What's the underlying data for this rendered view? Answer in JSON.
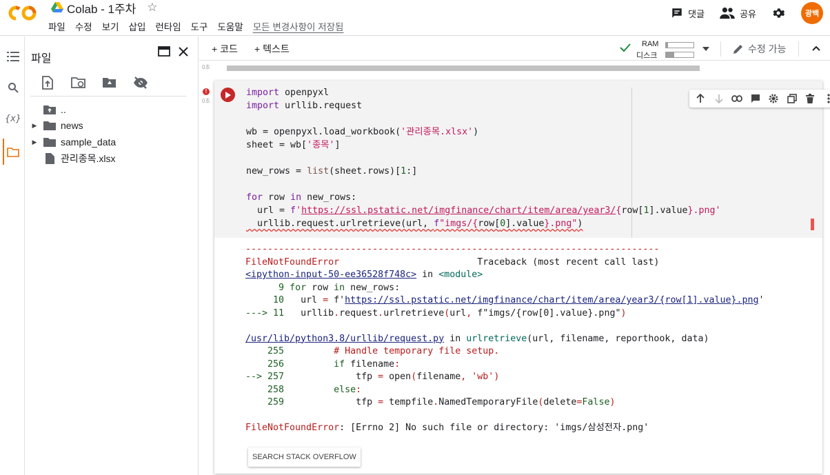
{
  "header": {
    "logo": "CO",
    "title": "Colab - 1주차",
    "menu": [
      "파일",
      "수정",
      "보기",
      "삽입",
      "런타임",
      "도구",
      "도움말"
    ],
    "saved_status": "모든 변경사항이 저장됨",
    "comment_label": "댓글",
    "share_label": "공유",
    "avatar_text": "광백"
  },
  "sidebar": {
    "title": "파일",
    "tree": [
      {
        "name": "..",
        "type": "up"
      },
      {
        "name": "news",
        "type": "folder"
      },
      {
        "name": "sample_data",
        "type": "folder"
      },
      {
        "name": "관리종목.xlsx",
        "type": "file"
      }
    ]
  },
  "toolbar": {
    "add_code": "+ 코드",
    "add_text": "+ 텍스트",
    "ram_label": "RAM",
    "disk_label": "디스크",
    "ram_usage": 0.08,
    "disk_usage": 0.3,
    "edit_mode": "수정 가능"
  },
  "cell": {
    "exec_time": "0초",
    "prev_exec_time": "0초"
  },
  "output": {
    "so_button": "SEARCH STACK OVERFLOW"
  },
  "colors": {
    "accent": "#e8710a",
    "error": "#c62828",
    "ok": "#1e8e3e"
  }
}
